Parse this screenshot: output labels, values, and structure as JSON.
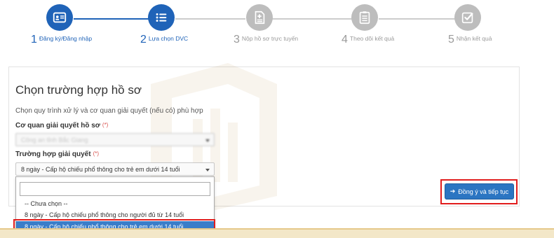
{
  "stepper": {
    "steps": [
      {
        "num": "1",
        "label": "Đăng ký/Đăng nhập",
        "state": "done",
        "icon": "id-card-icon"
      },
      {
        "num": "2",
        "label": "Lựa chọn DVC",
        "state": "active",
        "icon": "list-icon"
      },
      {
        "num": "3",
        "label": "Nộp hồ sơ trực tuyến",
        "state": "todo",
        "icon": "document-plus-icon"
      },
      {
        "num": "4",
        "label": "Theo dõi kết quả",
        "state": "todo",
        "icon": "clipboard-icon"
      },
      {
        "num": "5",
        "label": "Nhận kết quả",
        "state": "todo",
        "icon": "check-square-icon"
      }
    ],
    "active_color": "#1f63b8",
    "inactive_color": "#bdbdbd"
  },
  "panel": {
    "title": "Chọn trường hợp hồ sơ",
    "subtitle": "Chọn quy trình xử lý và cơ quan giải quyết (nếu có) phù hợp"
  },
  "fields": {
    "agency": {
      "label": "Cơ quan giải quyết hồ sơ",
      "required_mark": "(*)",
      "value": "Công an tỉnh Bắc Giang"
    },
    "case": {
      "label": "Trường hợp giải quyết",
      "required_mark": "(*)",
      "value": "8 ngày - Cấp hộ chiếu phổ thông cho trẻ em dưới 14 tuổi"
    }
  },
  "dropdown": {
    "search_value": "",
    "options": [
      "-- Chưa chọn --",
      "8 ngày - Cấp hộ chiếu phổ thông cho người đủ từ 14 tuổi",
      "8 ngày - Cấp hộ chiếu phổ thông cho trẻ em dưới 14 tuổi"
    ],
    "selected_index": 2
  },
  "buttons": {
    "continue_label": "Đồng ý và tiếp tục",
    "continue_icon": "arrow-right-icon"
  },
  "colors": {
    "primary": "#2b75c2",
    "highlight": "#e11d1d",
    "selected_option": "#3a7dc9",
    "required": "#d9534f"
  }
}
